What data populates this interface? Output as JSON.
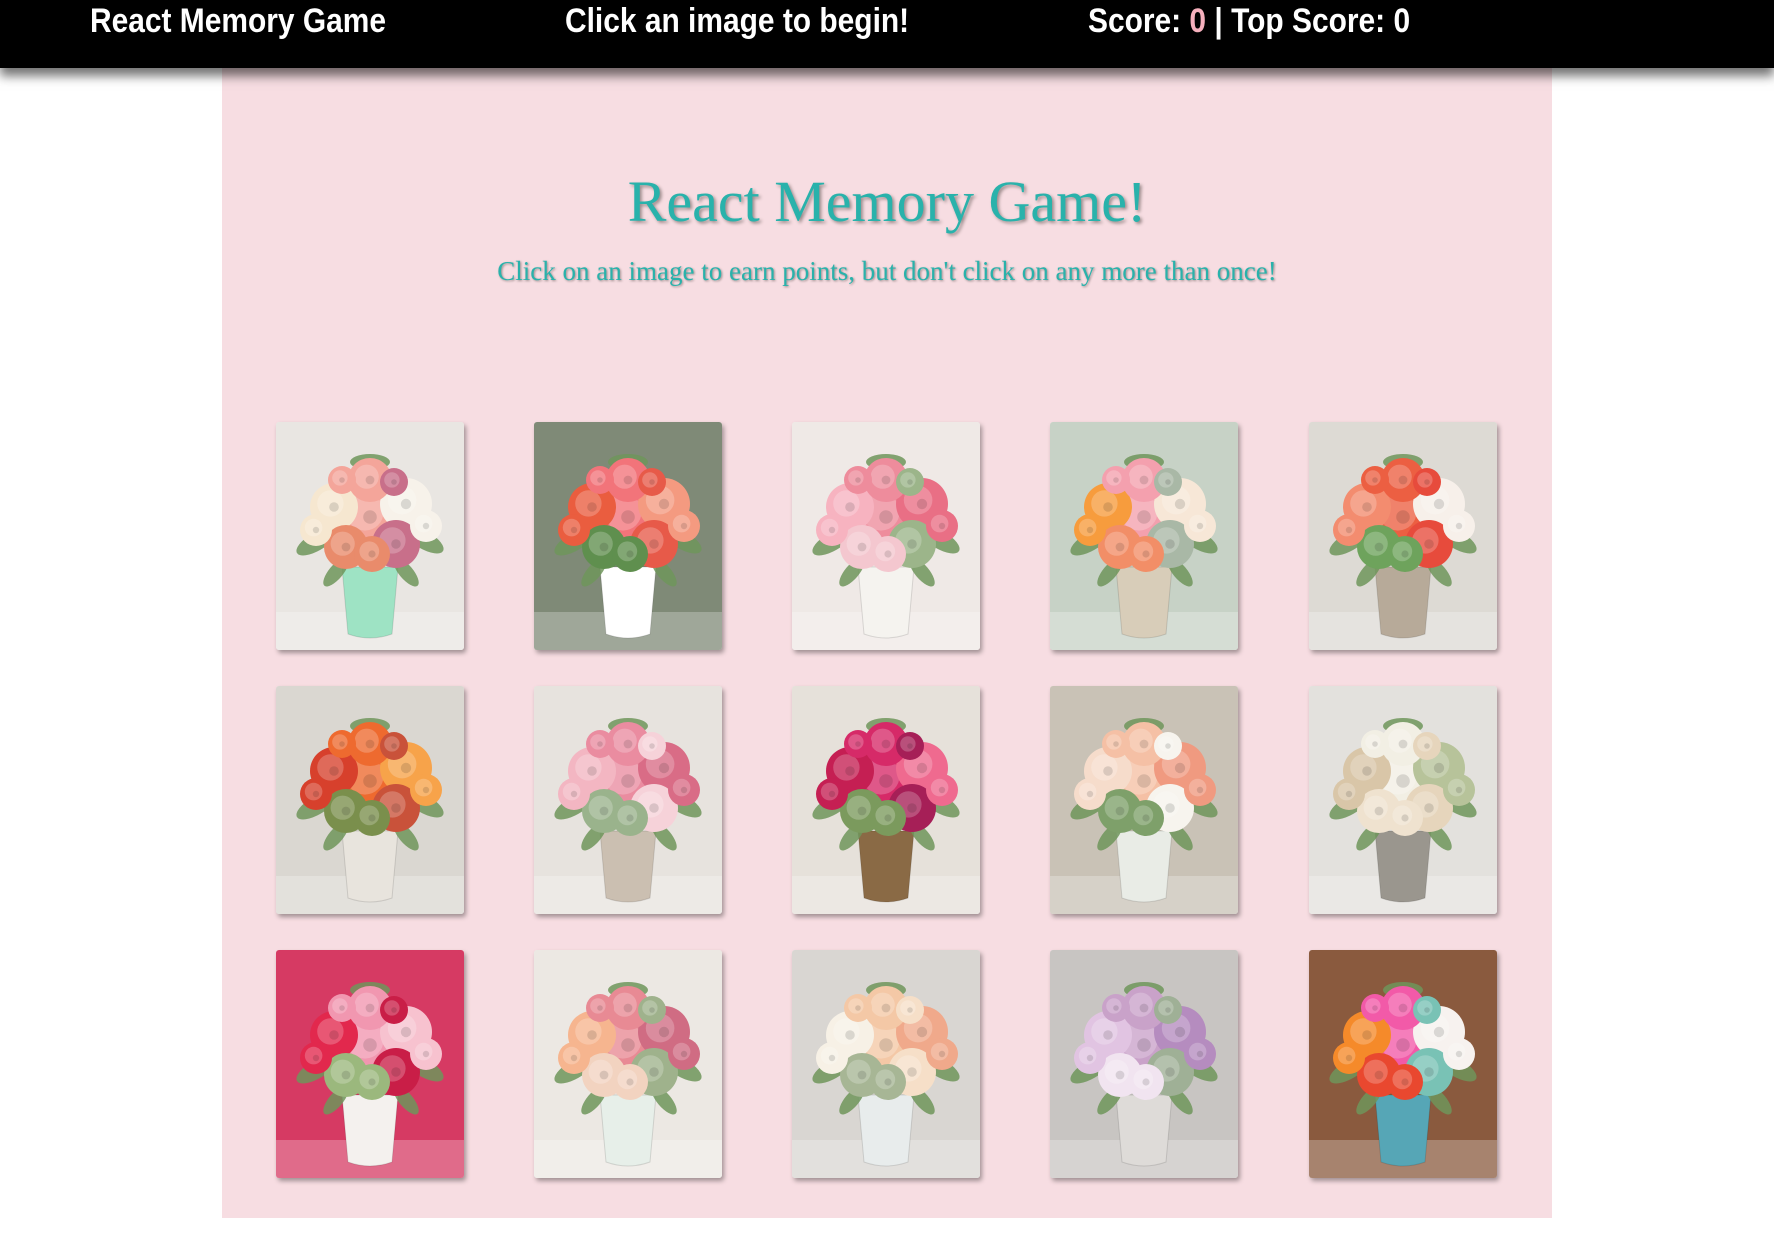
{
  "navbar": {
    "brand": "React Memory Game",
    "message": "Click an image to begin!",
    "score_label": "Score: ",
    "score_value": "0",
    "separator": " | ",
    "top_score_label": "Top Score: ",
    "top_score_value": "0"
  },
  "hero": {
    "title": "React Memory Game!",
    "subtitle": "Click on an image to earn points, but don't click on any more than once!"
  },
  "cards": [
    {
      "icon": "flower-bouquet-image",
      "bg": "#e9e6e2",
      "vase": "#9ee3c4",
      "flowers": [
        "#f4a59a",
        "#f6e7d0",
        "#f7f2ea",
        "#e98b6b",
        "#c86f8a"
      ]
    },
    {
      "icon": "flower-bouquet-image",
      "bg": "#7f8a77",
      "vase": "#ffffff",
      "flowers": [
        "#f2747a",
        "#ea5d3f",
        "#f49a80",
        "#5f8f4e",
        "#e75a49"
      ]
    },
    {
      "icon": "flower-bouquet-image",
      "bg": "#efe9e6",
      "vase": "#f5f3ef",
      "flowers": [
        "#ee8c9c",
        "#f7b3c0",
        "#e96f85",
        "#f4c7cf",
        "#9cb58a"
      ]
    },
    {
      "icon": "flower-bouquet-image",
      "bg": "#c7d2c6",
      "vase": "#d8cdb9",
      "flowers": [
        "#f4a0ae",
        "#f79c3d",
        "#f7e7d7",
        "#f28e67",
        "#a9b8a6"
      ]
    },
    {
      "icon": "flower-bouquet-image",
      "bg": "#dddad4",
      "vase": "#b7aa99",
      "flowers": [
        "#ec5f42",
        "#f38c6f",
        "#f7f0ea",
        "#6ea35c",
        "#e74b3c"
      ]
    },
    {
      "icon": "flower-bouquet-image",
      "bg": "#dad7d1",
      "vase": "#e8e4dd",
      "flowers": [
        "#ee6a2f",
        "#d7402c",
        "#f7a34a",
        "#7a8f4c",
        "#c9523a"
      ]
    },
    {
      "icon": "flower-bouquet-image",
      "bg": "#e7e3de",
      "vase": "#cbbfb1",
      "flowers": [
        "#ea8ca0",
        "#f3b6c2",
        "#d96c86",
        "#9ab38c",
        "#f6d2d9"
      ]
    },
    {
      "icon": "flower-bouquet-image",
      "bg": "#e6e1da",
      "vase": "#8a6a45",
      "flowers": [
        "#d62a68",
        "#c51f53",
        "#ef6a8f",
        "#7b9a5d",
        "#a61f57"
      ]
    },
    {
      "icon": "flower-bouquet-image",
      "bg": "#c9c2b6",
      "vase": "#e9ece6",
      "flowers": [
        "#f5c0a5",
        "#f6dccb",
        "#f09a80",
        "#7ea06a",
        "#f7f4ee"
      ]
    },
    {
      "icon": "flower-bouquet-image",
      "bg": "#e3e1dd",
      "vase": "#9a968e",
      "flowers": [
        "#f2efe4",
        "#d9c6a8",
        "#b7c39a",
        "#efe2cf",
        "#e6d5bc"
      ]
    },
    {
      "icon": "flower-bouquet-image",
      "bg": "#d63a63",
      "vase": "#f4f1ee",
      "flowers": [
        "#f197b0",
        "#e2284d",
        "#f7c2cf",
        "#9bb87d",
        "#c91e47"
      ]
    },
    {
      "icon": "flower-bouquet-image",
      "bg": "#ece8e3",
      "vase": "#e7efe9",
      "flowers": [
        "#e88a94",
        "#f6b58f",
        "#d06c83",
        "#f2d3c0",
        "#9fb28c"
      ]
    },
    {
      "icon": "flower-bouquet-image",
      "bg": "#d9d6d2",
      "vase": "#e8ecec",
      "flowers": [
        "#f4c8a6",
        "#f7f1e6",
        "#f0a98b",
        "#a7b695",
        "#f6dfc8"
      ]
    },
    {
      "icon": "flower-bouquet-image",
      "bg": "#c8c5c2",
      "vase": "#dedbd8",
      "flowers": [
        "#c9a2c9",
        "#e1c4e2",
        "#b58cbf",
        "#f1e4f0",
        "#9fb096"
      ]
    },
    {
      "icon": "flower-bouquet-image",
      "bg": "#8a5a3e",
      "vase": "#56a6b6",
      "flowers": [
        "#f25aa8",
        "#f58a2a",
        "#f7f2ef",
        "#e9482f",
        "#79c2b5"
      ]
    }
  ]
}
